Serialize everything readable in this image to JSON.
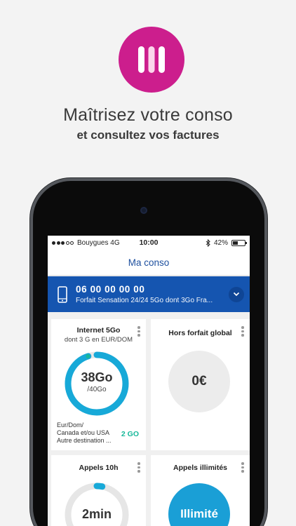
{
  "header": {
    "headline": "Maîtrisez votre conso",
    "subline": "et consultez vos factures",
    "app_icon": "bars-logo-icon",
    "brand_color": "#cc1e8d"
  },
  "status_bar": {
    "carrier": "Bouygues 4G",
    "time": "10:00",
    "battery": "42%",
    "battery_level": 0.42
  },
  "nav": {
    "title": "Ma conso"
  },
  "line": {
    "number": "06 00 00 00 00",
    "plan": "Forfait Sensation 24/24 5Go dont 3Go Fra...",
    "color": "#1555b0"
  },
  "cards": {
    "internet": {
      "title": "Internet 5Go",
      "subtitle": "dont 3 G en EUR/DOM",
      "used": "38Go",
      "total": "/40Go",
      "usage_fraction": 0.95,
      "destinations": [
        "Eur/Dom/",
        "Canada et/ou USA",
        "Autre destination ..."
      ],
      "badge": "2 GO",
      "ring_color": "#17a9d8",
      "ring_end_color": "#17b89a"
    },
    "hors_forfait": {
      "title": "Hors forfait global",
      "amount": "0€"
    },
    "appels": {
      "title": "Appels 10h",
      "used": "2min",
      "usage_fraction": 0.03
    },
    "appels_illimites": {
      "title": "Appels illimités",
      "label": "Illimité",
      "color": "#1a9fd6"
    }
  }
}
